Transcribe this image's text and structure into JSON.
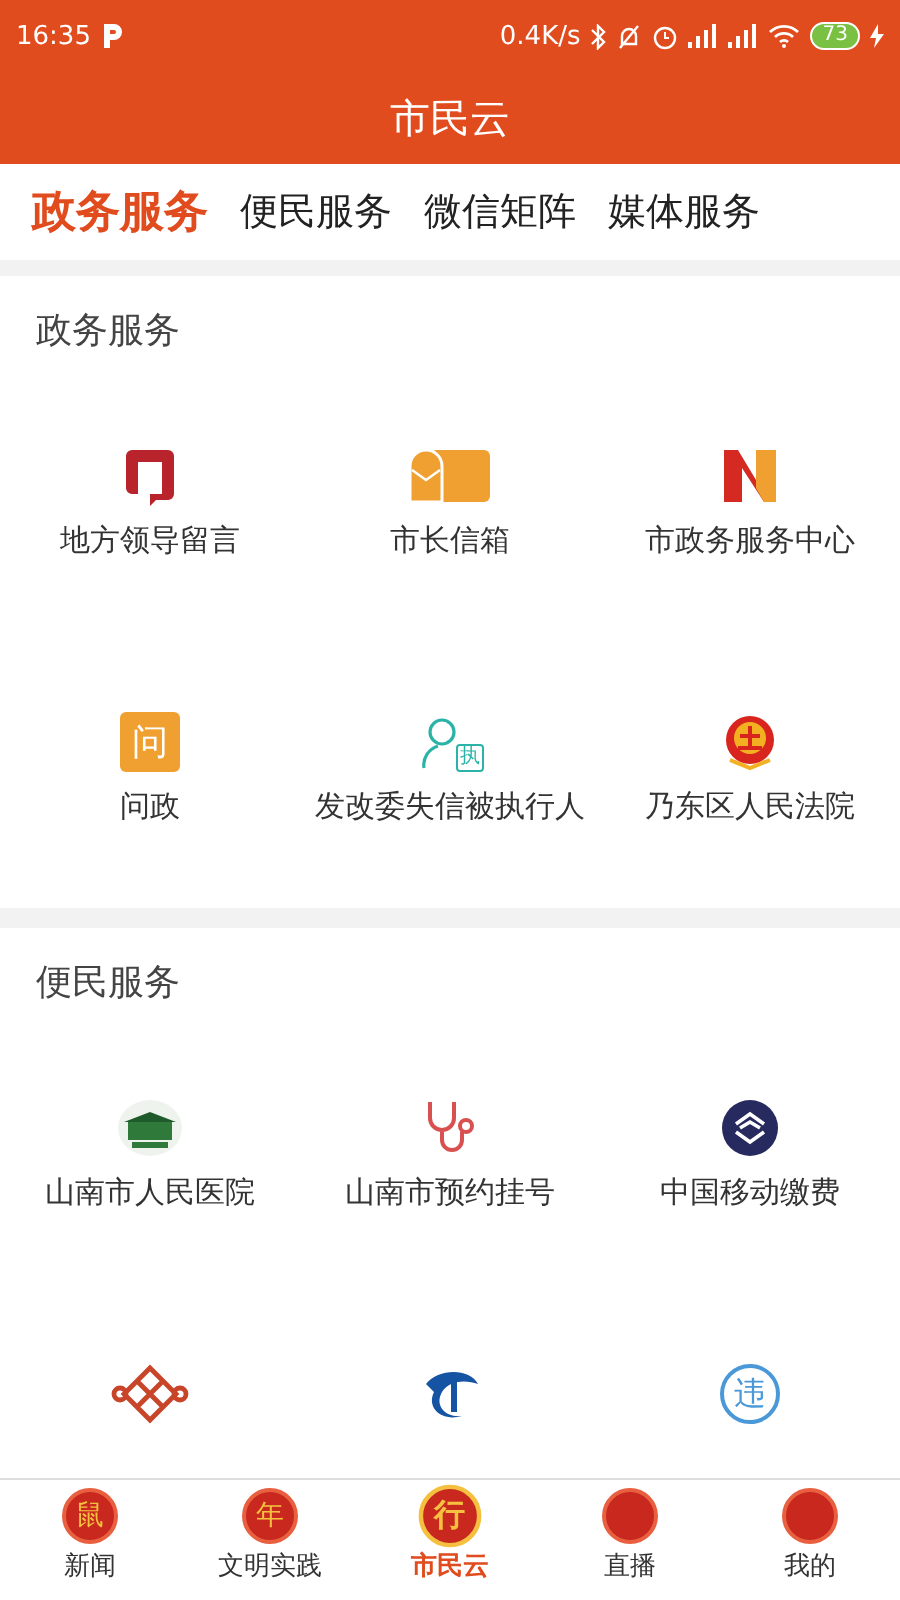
{
  "status_bar": {
    "time": "16:35",
    "network_speed": "0.4K/s",
    "battery": "73"
  },
  "header": {
    "title": "市民云"
  },
  "tabs": [
    {
      "label": "政务服务",
      "selected": true
    },
    {
      "label": "便民服务",
      "selected": false
    },
    {
      "label": "微信矩阵",
      "selected": false
    },
    {
      "label": "媒体服务",
      "selected": false
    }
  ],
  "sections": [
    {
      "title": "政务服务",
      "items": [
        {
          "label": "地方领导留言"
        },
        {
          "label": "市长信箱"
        },
        {
          "label": "市政务服务中心"
        },
        {
          "label": "问政",
          "icon_text": "问"
        },
        {
          "label": "发改委失信被执行人",
          "icon_text": "执"
        },
        {
          "label": "乃东区人民法院"
        }
      ]
    },
    {
      "title": "便民服务",
      "items": [
        {
          "label": "山南市人民医院"
        },
        {
          "label": "山南市预约挂号"
        },
        {
          "label": "中国移动缴费"
        },
        {
          "kind": "icon_only"
        },
        {
          "kind": "icon_only"
        },
        {
          "kind": "icon_only",
          "icon_text": "违"
        }
      ]
    }
  ],
  "bottom_nav": [
    {
      "label": "新闻",
      "icon_text": "鼠",
      "selected": false
    },
    {
      "label": "文明实践",
      "icon_text": "年",
      "selected": false
    },
    {
      "label": "市民云",
      "icon_text": "行",
      "selected": true
    },
    {
      "label": "直播",
      "selected": false
    },
    {
      "label": "我的",
      "selected": false
    }
  ]
}
